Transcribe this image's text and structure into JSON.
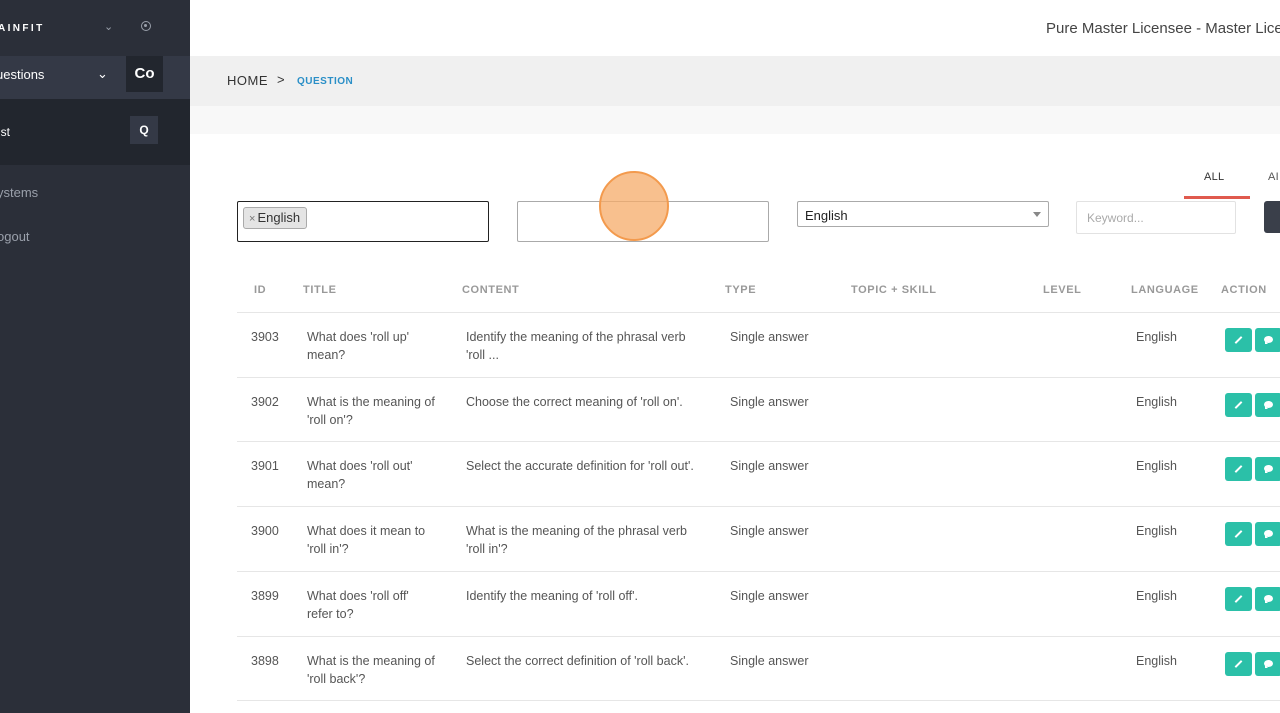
{
  "sidebar": {
    "brand": "AINFIT",
    "questions_label": "uestions",
    "co_label": "Co",
    "list_label": "ist",
    "q_label": "Q",
    "nav": [
      {
        "label": "ystems"
      },
      {
        "label": "ogout"
      }
    ]
  },
  "header": {
    "user": "Pure Master Licensee - Master Lice"
  },
  "breadcrumb": {
    "home": "HOME",
    "separator": ">",
    "current": "QUESTION"
  },
  "tabs": [
    {
      "label": "ALL",
      "active": true
    },
    {
      "label": "AI"
    }
  ],
  "filters": {
    "language_tag": "English",
    "tag_remove": "×",
    "language_select": "English",
    "keyword_placeholder": "Keyword..."
  },
  "table": {
    "headers": [
      "ID",
      "TITLE",
      "CONTENT",
      "TYPE",
      "TOPIC + SKILL",
      "LEVEL",
      "LANGUAGE",
      "ACTION"
    ],
    "rows": [
      {
        "id": "3903",
        "title": "What does 'roll up' mean?",
        "content": "Identify the meaning of the phrasal verb 'roll ...",
        "type": "Single answer",
        "topic": "",
        "level": "",
        "language": "English"
      },
      {
        "id": "3902",
        "title": "What is the meaning of 'roll on'?",
        "content": "Choose the correct meaning of 'roll on'.",
        "type": "Single answer",
        "topic": "",
        "level": "",
        "language": "English"
      },
      {
        "id": "3901",
        "title": "What does 'roll out' mean?",
        "content": "Select the accurate definition for 'roll out'.",
        "type": "Single answer",
        "topic": "",
        "level": "",
        "language": "English"
      },
      {
        "id": "3900",
        "title": "What does it mean to 'roll in'?",
        "content": "What is the meaning of the phrasal verb 'roll in'?",
        "type": "Single answer",
        "topic": "",
        "level": "",
        "language": "English"
      },
      {
        "id": "3899",
        "title": "What does 'roll off' refer to?",
        "content": "Identify the meaning of 'roll off'.",
        "type": "Single answer",
        "topic": "",
        "level": "",
        "language": "English"
      },
      {
        "id": "3898",
        "title": "What is the meaning of 'roll back'?",
        "content": "Select the correct definition of 'roll back'.",
        "type": "Single answer",
        "topic": "",
        "level": "",
        "language": "English"
      }
    ]
  },
  "colors": {
    "sidebar_bg": "#2b2f39",
    "accent_blue": "#2a8fc7",
    "tab_underline": "#e05a4e",
    "action_green": "#2bc0a8",
    "click_marker": "#f6ab68"
  }
}
